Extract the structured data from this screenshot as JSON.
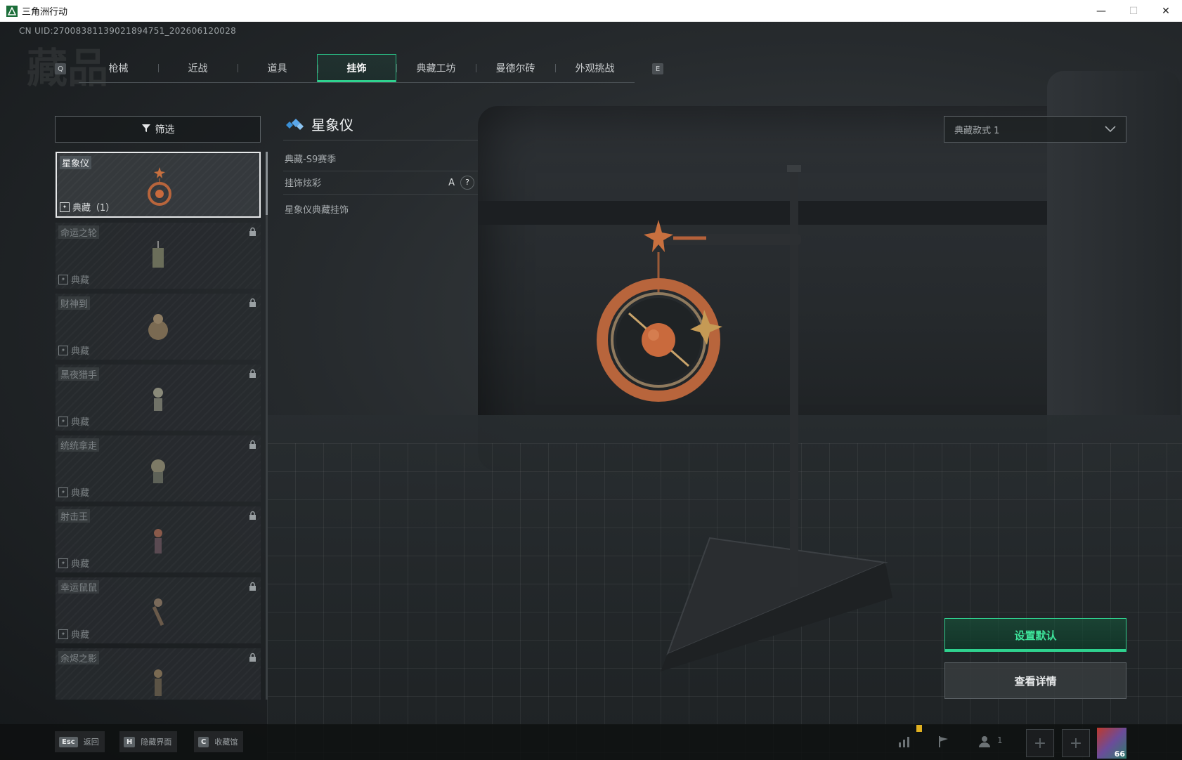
{
  "window": {
    "title": "三角洲行动",
    "minimize": "—",
    "maximize": "☐",
    "close": "✕"
  },
  "uid": "CN UID:27008381139021894751_202606120028",
  "watermark": "藏品",
  "tabs": {
    "key_left": "Q",
    "key_right": "E",
    "items": [
      {
        "label": "枪械"
      },
      {
        "label": "近战"
      },
      {
        "label": "道具"
      },
      {
        "label": "挂饰"
      },
      {
        "label": "典藏工坊"
      },
      {
        "label": "曼德尔砖"
      },
      {
        "label": "外观挑战"
      }
    ],
    "active": "挂饰"
  },
  "filter": {
    "label": "筛选"
  },
  "charms": [
    {
      "name": "星象仪",
      "tag": "典藏（1）",
      "selected": true,
      "locked": false
    },
    {
      "name": "命运之轮",
      "tag": "典藏",
      "selected": false,
      "locked": true
    },
    {
      "name": "财神到",
      "tag": "典藏",
      "selected": false,
      "locked": true
    },
    {
      "name": "黑夜猎手",
      "tag": "典藏",
      "selected": false,
      "locked": true
    },
    {
      "name": "统统拿走",
      "tag": "典藏",
      "selected": false,
      "locked": true
    },
    {
      "name": "射击王",
      "tag": "典藏",
      "selected": false,
      "locked": true
    },
    {
      "name": "幸运鼠鼠",
      "tag": "典藏",
      "selected": false,
      "locked": true
    },
    {
      "name": "余烬之影",
      "tag": "",
      "selected": false,
      "locked": true
    }
  ],
  "detail": {
    "title": "星象仪",
    "season": "典藏-S9赛季",
    "fx_label": "挂饰炫彩",
    "fx_grade": "A",
    "fx_help": "?",
    "description": "星象仪典藏挂饰"
  },
  "style_select": {
    "value": "典藏款式 1"
  },
  "buttons": {
    "set_default": "设置默认",
    "view_details": "查看详情"
  },
  "hints": [
    {
      "key": "Esc",
      "label": "返回"
    },
    {
      "key": "H",
      "label": "隐藏界面"
    },
    {
      "key": "C",
      "label": "收藏馆"
    }
  ],
  "social": {
    "friends_count": "1",
    "avatar_level": "66"
  },
  "colors": {
    "accent": "#2fd28f",
    "copper": "#c8703f"
  }
}
